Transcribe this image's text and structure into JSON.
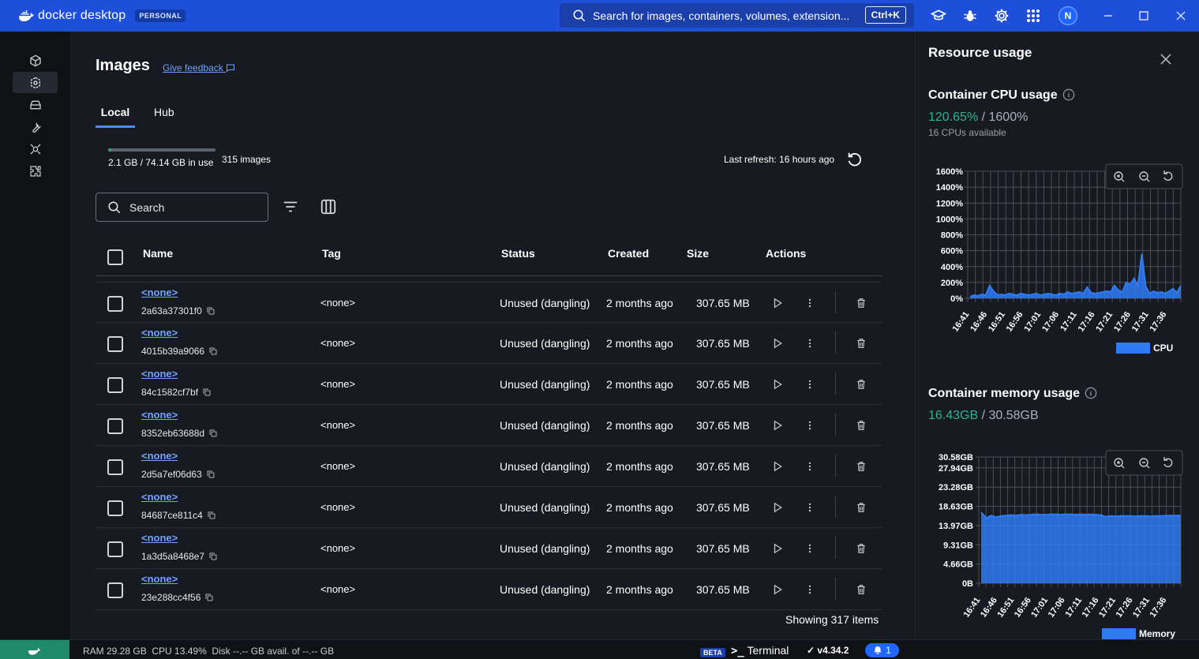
{
  "titlebar": {
    "brand": "docker desktop",
    "plan": "PERSONAL",
    "search_placeholder": "Search for images, containers, volumes, extension...",
    "shortcut": "Ctrl+K",
    "avatar_initial": "N"
  },
  "leftnav": {
    "items": [
      {
        "icon": "containers-icon"
      },
      {
        "icon": "images-icon",
        "active": true
      },
      {
        "icon": "volumes-icon"
      },
      {
        "icon": "builds-icon"
      },
      {
        "icon": "scout-icon"
      },
      {
        "icon": "extensions-icon"
      }
    ]
  },
  "page": {
    "title": "Images",
    "feedback_label": "Give feedback",
    "tabs": [
      {
        "label": "Local",
        "active": true
      },
      {
        "label": "Hub"
      }
    ],
    "disk_usage_text": "2.1 GB / 74.14 GB in use",
    "disk_usage_fraction": 0.028,
    "images_count": "315 images",
    "last_refresh": "Last refresh: 16 hours ago",
    "search_placeholder": "Search",
    "showing": "Showing 317 items"
  },
  "table": {
    "columns": {
      "name": "Name",
      "tag": "Tag",
      "status": "Status",
      "created": "Created",
      "size": "Size",
      "actions": "Actions"
    },
    "rows": [
      {
        "name": "<none>",
        "id": "2a63a37301f0",
        "tag": "<none>",
        "status": "Unused (dangling)",
        "created": "2 months ago",
        "size": "307.65 MB"
      },
      {
        "name": "<none>",
        "id": "4015b39a9066",
        "tag": "<none>",
        "status": "Unused (dangling)",
        "created": "2 months ago",
        "size": "307.65 MB"
      },
      {
        "name": "<none>",
        "id": "84c1582cf7bf",
        "tag": "<none>",
        "status": "Unused (dangling)",
        "created": "2 months ago",
        "size": "307.65 MB"
      },
      {
        "name": "<none>",
        "id": "8352eb63688d",
        "tag": "<none>",
        "status": "Unused (dangling)",
        "created": "2 months ago",
        "size": "307.65 MB"
      },
      {
        "name": "<none>",
        "id": "2d5a7ef06d63",
        "tag": "<none>",
        "status": "Unused (dangling)",
        "created": "2 months ago",
        "size": "307.65 MB"
      },
      {
        "name": "<none>",
        "id": "84687ce811c4",
        "tag": "<none>",
        "status": "Unused (dangling)",
        "created": "2 months ago",
        "size": "307.65 MB"
      },
      {
        "name": "<none>",
        "id": "1a3d5a8468e7",
        "tag": "<none>",
        "status": "Unused (dangling)",
        "created": "2 months ago",
        "size": "307.65 MB"
      },
      {
        "name": "<none>",
        "id": "23e288cc4f56",
        "tag": "<none>",
        "status": "Unused (dangling)",
        "created": "2 months ago",
        "size": "307.65 MB"
      }
    ]
  },
  "resource_panel": {
    "title": "Resource usage",
    "cpu": {
      "title": "Container CPU usage",
      "value": "120.65%",
      "total": " / 1600%",
      "sub": "16 CPUs available"
    },
    "memory": {
      "title": "Container memory usage",
      "value": "16.43GB",
      "total": " / 30.58GB"
    }
  },
  "chart_data": [
    {
      "type": "area",
      "title": "",
      "ylim": [
        0,
        1600
      ],
      "y_ticks": [
        "1600%",
        "1400%",
        "1200%",
        "1000%",
        "800%",
        "600%",
        "400%",
        "200%",
        "0%"
      ],
      "x_ticks": [
        "16:41",
        "16:46",
        "16:51",
        "16:56",
        "17:01",
        "17:06",
        "17:11",
        "17:16",
        "17:21",
        "17:26",
        "17:31",
        "17:36"
      ],
      "series": [
        {
          "name": "CPU",
          "color": "#2f7bf5",
          "values": [
            20,
            40,
            30,
            50,
            40,
            160,
            90,
            40,
            50,
            40,
            60,
            50,
            40,
            60,
            50,
            40,
            50,
            60,
            40,
            50,
            60,
            50,
            40,
            60,
            50,
            80,
            60,
            70,
            80,
            60,
            140,
            70,
            60,
            70,
            80,
            90,
            80,
            160,
            100,
            80,
            200,
            170,
            250,
            160,
            560,
            150,
            60,
            90,
            70,
            80,
            60,
            90,
            120,
            70,
            160
          ]
        }
      ]
    },
    {
      "type": "area",
      "title": "",
      "ylim": [
        0,
        30.58
      ],
      "y_ticks": [
        "30.58GB",
        "27.94GB",
        "23.28GB",
        "18.63GB",
        "13.97GB",
        "9.31GB",
        "4.66GB",
        "0B"
      ],
      "x_ticks": [
        "16:41",
        "16:46",
        "16:51",
        "16:56",
        "17:01",
        "17:06",
        "17:11",
        "17:16",
        "17:21",
        "17:26",
        "17:31",
        "17:36"
      ],
      "series": [
        {
          "name": "Memory",
          "color": "#2f7bf5",
          "values": [
            17.2,
            15.8,
            16.4,
            16.0,
            16.3,
            16.4,
            16.5,
            16.4,
            16.6,
            16.5,
            16.6,
            16.7,
            16.6,
            16.6,
            16.7,
            16.7,
            16.6,
            16.7,
            16.7,
            16.6,
            16.7,
            16.6,
            16.7,
            16.6,
            16.5,
            16.1,
            16.3,
            16.2,
            16.3,
            16.3,
            16.3,
            16.2,
            16.3,
            16.3,
            16.2,
            16.3,
            16.3,
            16.4,
            16.4,
            16.4,
            16.4
          ]
        }
      ]
    }
  ],
  "statusbar": {
    "stats": "RAM 29.28 GB  CPU 13.49%  Disk --.-- GB avail. of --.-- GB",
    "beta": "BETA",
    "terminal": "Terminal",
    "version": "v4.34.2",
    "notifications": "1"
  }
}
